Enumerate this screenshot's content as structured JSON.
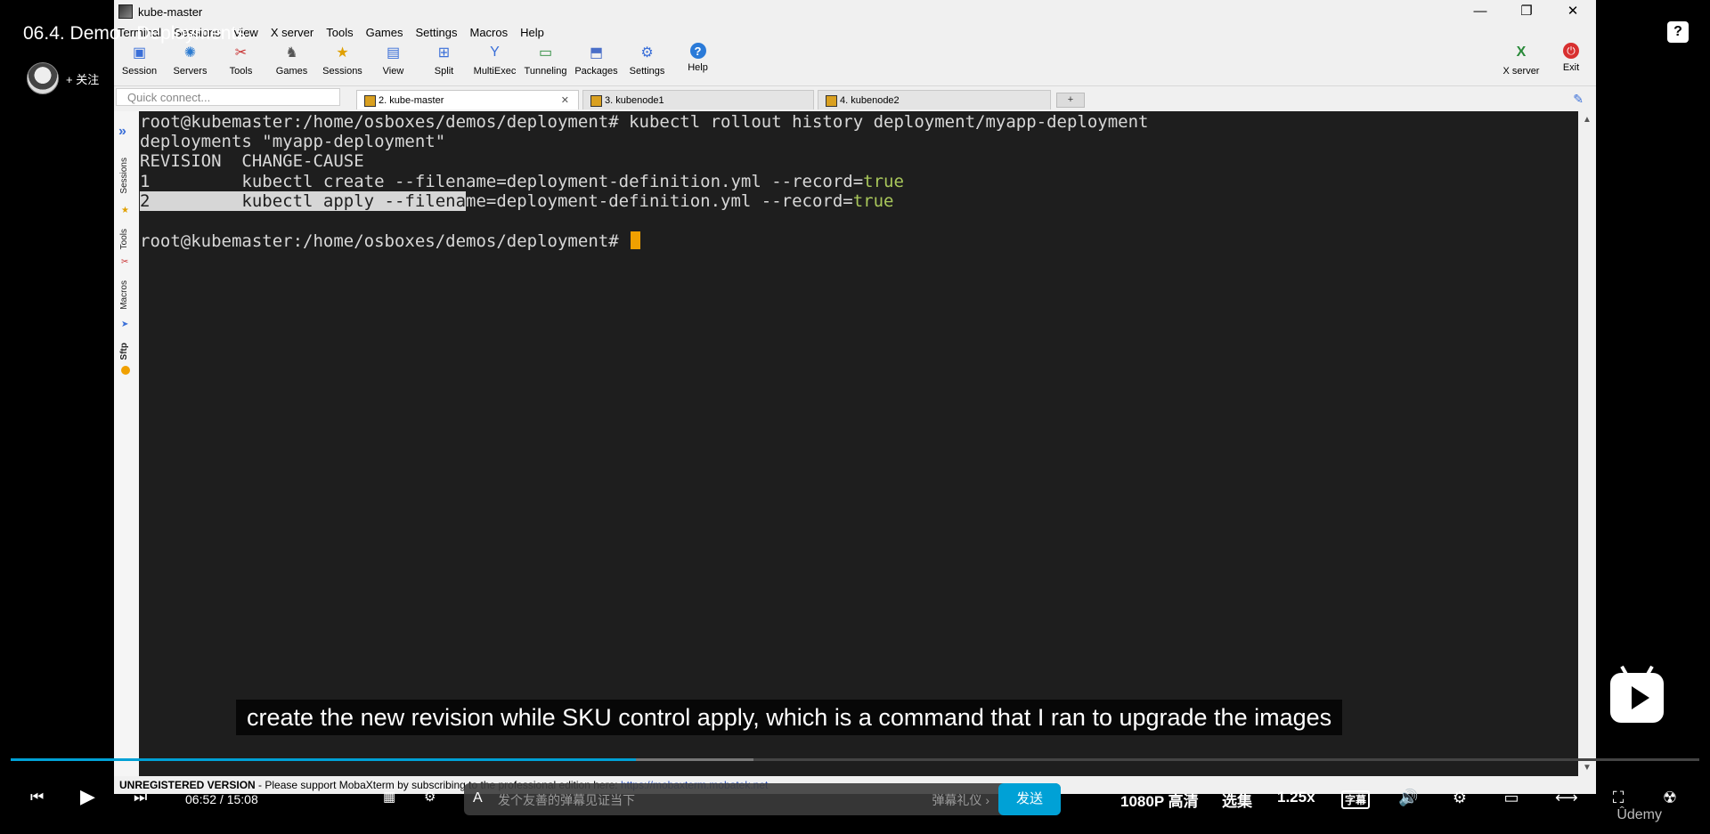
{
  "video": {
    "title": "06.4. Demo - Deployments",
    "follow_label": "+ 关注",
    "help_icon": "?"
  },
  "window": {
    "title": "kube-master",
    "minimize": "—",
    "restore": "❐",
    "close": "✕"
  },
  "menu": [
    "Terminal",
    "Sessions",
    "View",
    "X server",
    "Tools",
    "Games",
    "Settings",
    "Macros",
    "Help"
  ],
  "toolbar": {
    "items": [
      {
        "label": "Session",
        "icon": "session-icon"
      },
      {
        "label": "Servers",
        "icon": "servers-icon"
      },
      {
        "label": "Tools",
        "icon": "tools-icon"
      },
      {
        "label": "Games",
        "icon": "games-icon"
      },
      {
        "label": "Sessions",
        "icon": "star-icon"
      },
      {
        "label": "View",
        "icon": "view-icon"
      },
      {
        "label": "Split",
        "icon": "split-icon"
      },
      {
        "label": "MultiExec",
        "icon": "multiexec-icon"
      },
      {
        "label": "Tunneling",
        "icon": "tunneling-icon"
      },
      {
        "label": "Packages",
        "icon": "packages-icon"
      },
      {
        "label": "Settings",
        "icon": "settings-icon"
      },
      {
        "label": "Help",
        "icon": "help-icon"
      }
    ],
    "right": [
      {
        "label": "X server",
        "icon": "x-server-icon"
      },
      {
        "label": "Exit",
        "icon": "power-icon"
      }
    ]
  },
  "quick_connect": {
    "placeholder": "Quick connect..."
  },
  "tabs": [
    {
      "label": "2. kube-master",
      "active": true
    },
    {
      "label": "3. kubenode1",
      "active": false
    },
    {
      "label": "4. kubenode2",
      "active": false
    }
  ],
  "sidebar": {
    "tabs": [
      "Sessions",
      "Tools",
      "Macros",
      "Sftp"
    ]
  },
  "terminal": {
    "prompt": "root@kubemaster:/home/osboxes/demos/deployment# ",
    "command": "kubectl rollout history deployment/myapp-deployment",
    "line2": "deployments \"myapp-deployment\"",
    "line3": "REVISION  CHANGE-CAUSE",
    "line4_pre": "1         kubectl create --filename=deployment-definition.yml --record=",
    "line5_hl": "2         kubectl apply --filena",
    "line5_rest": "me=deployment-definition.yml --record=",
    "true_word": "true",
    "prompt2": "root@kubemaster:/home/osboxes/demos/deployment# "
  },
  "statusbar": {
    "unreg": "UNREGISTERED VERSION",
    "msg": "  -  Please support MobaXterm by subscribing to the professional edition here:  ",
    "link": "https://mobaxterm.mobatek.net"
  },
  "player": {
    "subtitle": "create the new revision while SKU control apply, which is a command that I ran to upgrade the images",
    "progress_played": 0.37,
    "progress_buffered": 0.44,
    "time": "06:52 / 15:08",
    "danmu_placeholder": "发个友善的弹幕见证当下",
    "gift": "弹幕礼仪 ›",
    "send": "发送",
    "quality": "1080P 高清",
    "episodes": "选集",
    "speed": "1.25x",
    "subtitle_btn": "字幕",
    "watermark": "Ûdemy"
  }
}
